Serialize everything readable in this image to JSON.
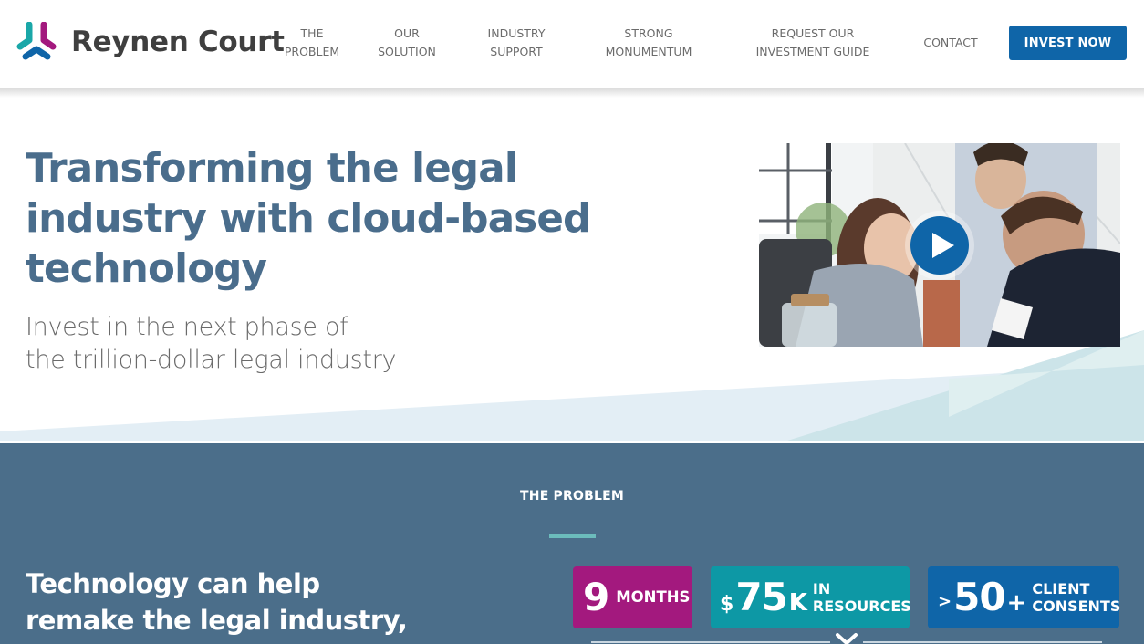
{
  "header": {
    "brand": "Reynen Court",
    "nav": [
      {
        "line1": "THE",
        "line2": "PROBLEM"
      },
      {
        "line1": "OUR",
        "line2": "SOLUTION"
      },
      {
        "line1": "INDUSTRY",
        "line2": "SUPPORT"
      },
      {
        "line1": "STRONG",
        "line2": "MONUMENTUM"
      },
      {
        "line1": "REQUEST OUR",
        "line2": "INVESTMENT GUIDE"
      },
      {
        "line1": "CONTACT"
      }
    ],
    "cta_label": "INVEST NOW"
  },
  "hero": {
    "title": "Transforming the legal industry with cloud-based technology",
    "subtitle_line1": "Invest in the next phase of",
    "subtitle_line2": "the trillion-dollar legal industry",
    "video_icon": "play-icon"
  },
  "problem": {
    "label": "THE PROBLEM",
    "heading_line1": "Technology can help",
    "heading_line2": "remake the legal industry,",
    "stats": [
      {
        "value": "9",
        "label": "MONTHS",
        "color": "#a3197e"
      },
      {
        "prefix": "$",
        "value": "75",
        "suffix": "K",
        "label_line1": "IN",
        "label_line2": "RESOURCES",
        "color": "#0d98a5"
      },
      {
        "prefix": ">",
        "value": "50",
        "suffix": "+",
        "label_line1": "CLIENT",
        "label_line2": "CONSENTS",
        "color": "#0f65a8"
      }
    ],
    "expand_icon": "chevron-down-icon"
  },
  "colors": {
    "brand_blue": "#0f65a8",
    "heading_slate": "#4a6d8c",
    "section_bg": "#4b6e8a",
    "accent_teal": "#6cbcbc",
    "magenta": "#a3197e",
    "teal": "#0d98a5"
  }
}
